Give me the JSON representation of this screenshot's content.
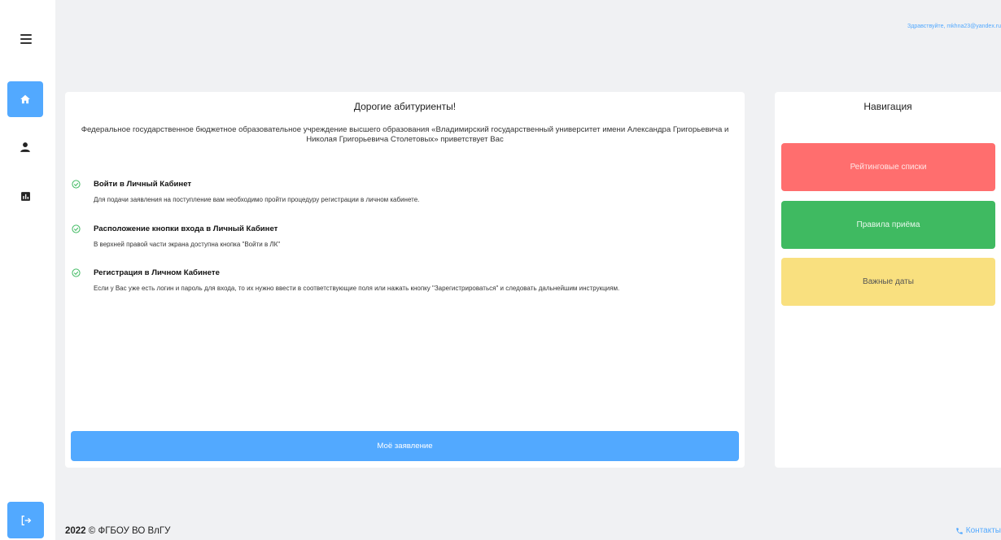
{
  "header": {
    "greeting": "Здравствуйте, mkhna23@yandex.ru"
  },
  "sidebar": {
    "items": [
      {
        "icon": "menu-icon"
      },
      {
        "icon": "home-icon",
        "active": true
      },
      {
        "icon": "user-icon"
      },
      {
        "icon": "chart-icon"
      }
    ],
    "logout_icon": "logout-icon"
  },
  "main": {
    "title": "Дорогие абитуриенты!",
    "intro": "Федеральное государственное бюджетное образовательное учреждение высшего образования «Владимирский государственный университет имени Александра Григорьевича и Николая Григорьевича Столетовых» приветствует Вас",
    "steps": [
      {
        "title": "Войти в Личный Кабинет",
        "description": "Для подачи заявления на поступление вам необходимо пройти процедуру регистрации в личном кабинете."
      },
      {
        "title": "Расположение кнопки входа в Личный Кабинет",
        "description": "В верхней правой части экрана доступна кнопка \"Войти в ЛК\""
      },
      {
        "title": "Регистрация в Личном Кабинете",
        "description": "Если у Вас уже есть логин и пароль для входа, то их нужно ввести в соответствующие поля или нажать кнопку \"Зарегистрироваться\" и следовать дальнейшим инструкциям."
      }
    ],
    "application_button": "Моё заявление"
  },
  "navigation": {
    "title": "Навигация",
    "buttons": [
      {
        "label": "Рейтинговые списки",
        "color": "#ff6e6e"
      },
      {
        "label": "Правила приёма",
        "color": "#3fba61"
      },
      {
        "label": "Важные даты",
        "color": "#f9e07f"
      }
    ]
  },
  "footer": {
    "year": "2022",
    "copyright": "© ФГБОУ ВО ВлГУ",
    "contacts": "Контакты"
  },
  "colors": {
    "accent": "#52a9ff",
    "check": "#3fba61"
  }
}
